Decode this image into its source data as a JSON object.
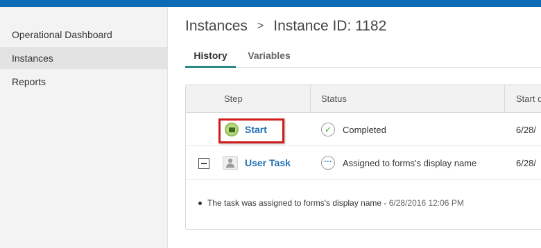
{
  "sidebar": {
    "items": [
      {
        "label": "Operational Dashboard"
      },
      {
        "label": "Instances"
      },
      {
        "label": "Reports"
      }
    ]
  },
  "breadcrumb": {
    "parent": "Instances",
    "separator": ">",
    "current": "Instance ID: 1182"
  },
  "tabs": [
    {
      "label": "History"
    },
    {
      "label": "Variables"
    }
  ],
  "table": {
    "columns": [
      "Step",
      "Status",
      "Start d"
    ],
    "rows": [
      {
        "step": "Start",
        "step_icon": "envelope-icon",
        "status": "Completed",
        "status_icon": "check-icon",
        "start": "6/28/"
      },
      {
        "step": "User Task",
        "step_icon": "user-icon",
        "status": "Assigned to forms's display name",
        "status_icon": "ellipsis-icon",
        "start": "6/28/"
      }
    ]
  },
  "detail": {
    "message": "The task was assigned to forms's display name - ",
    "timestamp": "6/28/2016 12:06 PM"
  },
  "colors": {
    "topbar": "#0b6bb5",
    "tab_accent": "#2a8a86",
    "link": "#1f6fb5",
    "highlight": "#d01c1c"
  }
}
